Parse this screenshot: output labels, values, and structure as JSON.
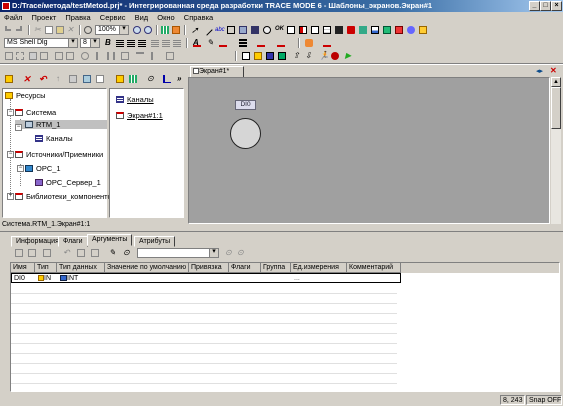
{
  "title": "D:/Trace/метода/testMetod.prj* - Интегрированная среда разработки TRACE MODE 6 - Шаблоны_экранов.Экран#1",
  "menu": [
    "Файл",
    "Проект",
    "Правка",
    "Сервис",
    "Вид",
    "Окно",
    "Справка"
  ],
  "toolbar": {
    "zoom": "100%",
    "font": "MS Shell Dlg",
    "font_size": "8"
  },
  "tree": {
    "items": [
      {
        "label": "Ресурсы"
      },
      {
        "label": "Система"
      },
      {
        "label": "RTM_1"
      },
      {
        "label": "Каналы"
      },
      {
        "label": "Источники/Приемники"
      },
      {
        "label": "OPC_1"
      },
      {
        "label": "OPC_Сервер_1"
      },
      {
        "label": "Библиотеки_компонентов"
      }
    ]
  },
  "middle": {
    "items": [
      {
        "label": "Каналы"
      },
      {
        "label": "Экран#1:1"
      }
    ]
  },
  "editor": {
    "tab": "Экран#1*",
    "element_label": "DI0"
  },
  "breadcrumb": "Система.RTM_1.Экран#1:1",
  "bottom_tabs": [
    "Информация",
    "Флаги",
    "Аргументы",
    "Атрибуты"
  ],
  "grid": {
    "columns": [
      "Имя",
      "Тип",
      "Тип данных",
      "Значение по умолчанию",
      "Привязка",
      "Флаги",
      "Группа",
      "Ед.измерения",
      "Комментарий"
    ],
    "rows": [
      {
        "name": "DI0",
        "type": "IN",
        "datatype": "INT",
        "default": "",
        "binding": "",
        "flags": "",
        "group": "",
        "unit": "...",
        "comment": ""
      }
    ]
  },
  "status": {
    "coords": "8, 243",
    "snap": "Snap OFF"
  },
  "colors": {
    "title_start": "#0a246a",
    "title_end": "#a6caf0",
    "editor_bg": "#a0a0a0",
    "window_bg": "#d4d0c8"
  }
}
